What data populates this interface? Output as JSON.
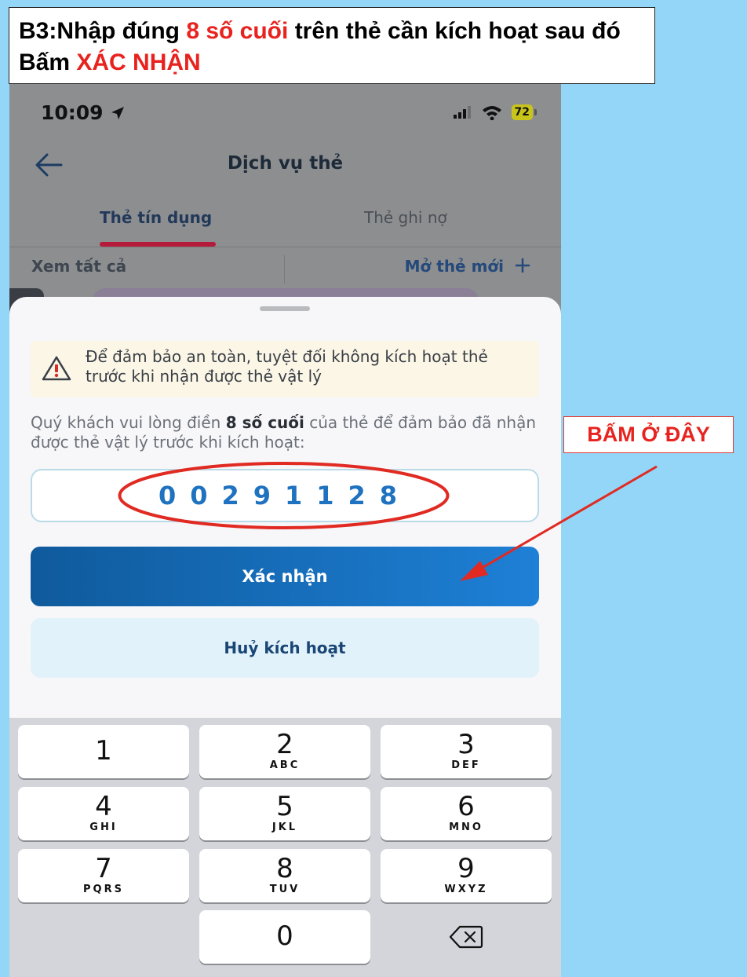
{
  "instruction": {
    "prefix": "B3:Nhập đúng ",
    "highlight1": "8 số cuối",
    "middle": " trên thẻ cần kích hoạt sau đó Bấm ",
    "highlight2": "XÁC NHẬN"
  },
  "status_bar": {
    "time": "10:09",
    "battery": "72"
  },
  "nav": {
    "title": "Dịch vụ thẻ"
  },
  "tabs": [
    {
      "label": "Thẻ tín dụng",
      "active": true
    },
    {
      "label": "Thẻ ghi nợ",
      "active": false
    }
  ],
  "actions": {
    "view_all": "Xem tất cả",
    "open_new": "Mở thẻ mới"
  },
  "sheet": {
    "warning": "Để đảm bảo an toàn, tuyệt đối không kích hoạt thẻ trước khi nhận được thẻ vật lý",
    "description_before": "Quý khách vui lòng điền ",
    "description_bold": "8 số cuối",
    "description_after": " của thẻ để đảm bảo đã nhận được thẻ vật lý trước khi kích hoạt:",
    "otp_value": "00291128",
    "confirm_label": "Xác nhận",
    "cancel_label": "Huỷ kích hoạt"
  },
  "keyboard": {
    "keys": [
      {
        "digit": "1",
        "letters": ""
      },
      {
        "digit": "2",
        "letters": "ABC"
      },
      {
        "digit": "3",
        "letters": "DEF"
      },
      {
        "digit": "4",
        "letters": "GHI"
      },
      {
        "digit": "5",
        "letters": "JKL"
      },
      {
        "digit": "6",
        "letters": "MNO"
      },
      {
        "digit": "7",
        "letters": "PQRS"
      },
      {
        "digit": "8",
        "letters": "TUV"
      },
      {
        "digit": "9",
        "letters": "WXYZ"
      },
      {
        "digit": "0",
        "letters": ""
      }
    ]
  },
  "annotation": {
    "callout": "BẤM Ở ĐÂY"
  },
  "colors": {
    "highlight": "#e8231f",
    "background": "#93d6f7",
    "primary_button": "#1e80d6"
  }
}
